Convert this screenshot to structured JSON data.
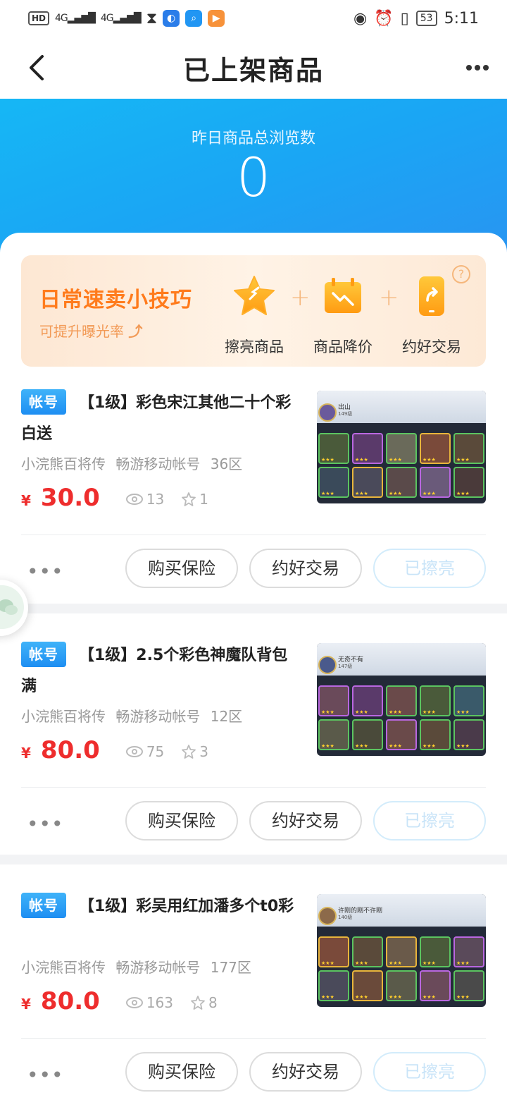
{
  "status_bar": {
    "network": "HD",
    "sim1": "4G",
    "sim2": "4G",
    "battery": "53",
    "time": "5:11"
  },
  "header": {
    "title": "已上架商品"
  },
  "banner": {
    "label": "昨日商品总浏览数",
    "value": "0"
  },
  "tips": {
    "title": "日常速卖小技巧",
    "subtitle": "可提升曝光率",
    "help": "?",
    "items": [
      {
        "label": "擦亮商品",
        "icon": "star-icon"
      },
      {
        "label": "商品降价",
        "icon": "price-drop-icon"
      },
      {
        "label": "约好交易",
        "icon": "phone-icon"
      }
    ],
    "plus": "+"
  },
  "listings": [
    {
      "badge": "帐号",
      "title": "【1级】彩色宋江其他二十个彩白送",
      "meta": "小浣熊百将传   畅游移动帐号   36区",
      "currency": "¥",
      "price": "30.0",
      "views": "13",
      "favorites": "1",
      "thumb_name": "出山",
      "thumb_level": "149级",
      "buttons": {
        "insurance": "购买保险",
        "trade": "约好交易",
        "polish": "已擦亮"
      }
    },
    {
      "badge": "帐号",
      "title": "【1级】2.5个彩色神魔队背包满",
      "meta": "小浣熊百将传   畅游移动帐号   12区",
      "currency": "¥",
      "price": "80.0",
      "views": "75",
      "favorites": "3",
      "thumb_name": "无奇不有",
      "thumb_level": "147级",
      "buttons": {
        "insurance": "购买保险",
        "trade": "约好交易",
        "polish": "已擦亮"
      }
    },
    {
      "badge": "帐号",
      "title": "【1级】彩吴用红加潘多个t0彩",
      "meta": "小浣熊百将传   畅游移动帐号   177区",
      "currency": "¥",
      "price": "80.0",
      "views": "163",
      "favorites": "8",
      "thumb_name": "许刚的刚不许刚",
      "thumb_level": "140级",
      "buttons": {
        "insurance": "购买保险",
        "trade": "约好交易",
        "polish": "已擦亮"
      }
    }
  ],
  "more_dots": "•••",
  "colors": {
    "accent_blue": "#1aa6f4",
    "price_red": "#ee2d2d",
    "tip_orange": "#ff7b1c"
  }
}
